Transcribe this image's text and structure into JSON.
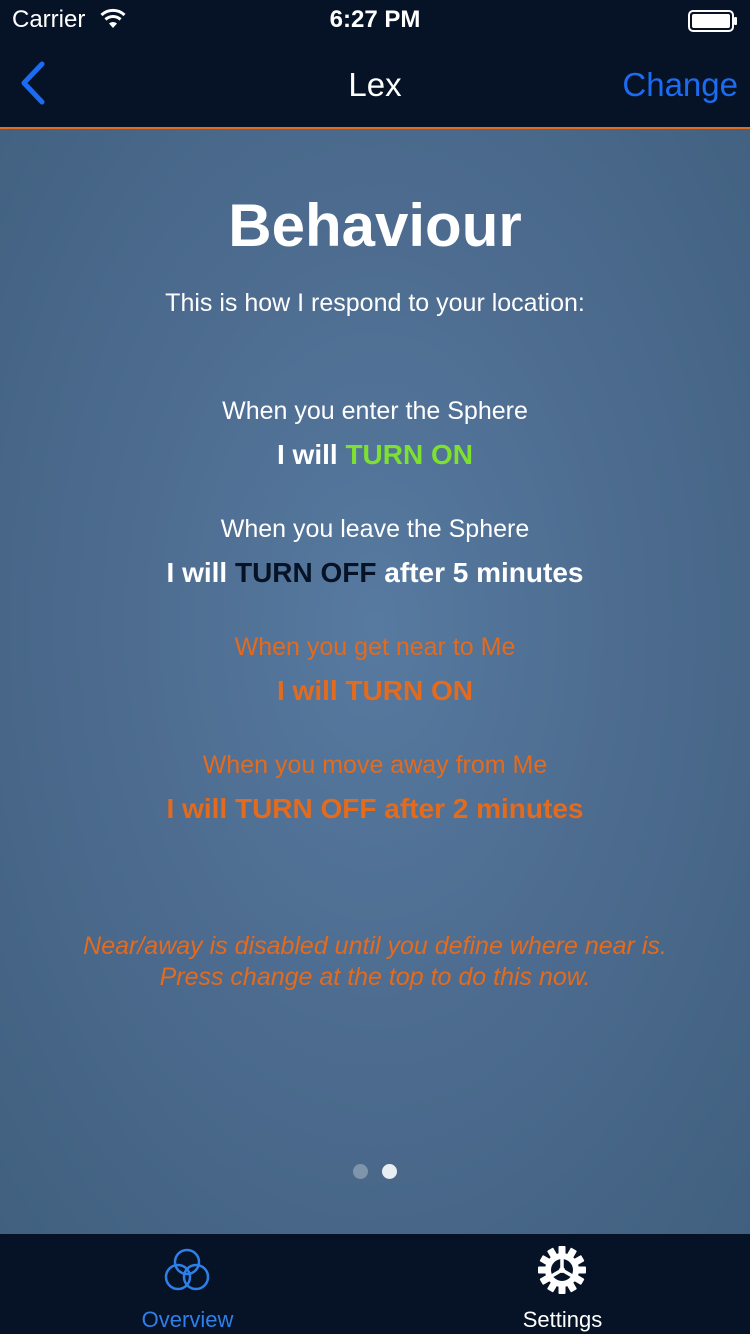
{
  "status_bar": {
    "carrier": "Carrier",
    "time": "6:27 PM"
  },
  "nav": {
    "title": "Lex",
    "right_button": "Change"
  },
  "content": {
    "title": "Behaviour",
    "subtitle": "This is how I respond to your location:",
    "rules": [
      {
        "when": "When you enter the Sphere",
        "prefix": "I will",
        "action": "TURN ON",
        "suffix": ""
      },
      {
        "when": "When you leave the Sphere",
        "prefix": "I will",
        "action": "TURN OFF",
        "suffix": "after 5 minutes"
      },
      {
        "when": "When you get near to Me",
        "prefix": "I will",
        "action": "TURN ON",
        "suffix": ""
      },
      {
        "when": "When you move away from Me",
        "prefix": "I will",
        "action": "TURN OFF",
        "suffix": "after 2 minutes"
      }
    ],
    "note_line1": "Near/away is disabled until you define where near is.",
    "note_line2": "Press change at the top to do this now.",
    "pager": {
      "pages": 2,
      "current": 2
    }
  },
  "tabs": [
    {
      "label": "Overview",
      "icon": "overview-circles-icon",
      "selected": true
    },
    {
      "label": "Settings",
      "icon": "settings-gear-icon",
      "selected": false
    }
  ],
  "colors": {
    "accent_orange": "#e46a1c",
    "turn_on_green": "#7ee02f",
    "link_blue": "#1b6cf2",
    "bar_background": "#061326"
  }
}
